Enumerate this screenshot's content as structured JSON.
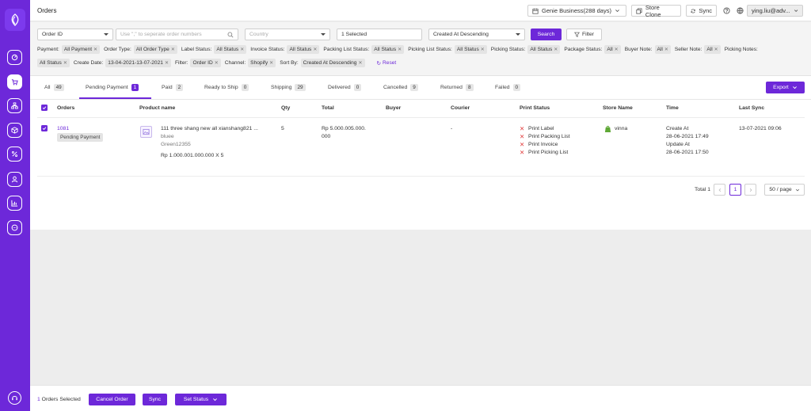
{
  "window": {
    "title": "Orders"
  },
  "topbar": {
    "business": "Genie Business(288 days)",
    "store_clone": "Store Clone",
    "sync": "Sync",
    "user": "ying.liu@adv..."
  },
  "filters": {
    "search_type": "Order ID",
    "order_numbers_placeholder": "Use \",\" to seperate order numbers",
    "country_placeholder": "Country",
    "selected": "1 Selected",
    "sort": "Created At Descending",
    "search_button": "Search",
    "filter_button": "Filter",
    "row1": [
      {
        "label": "Payment:",
        "value": "All Payment"
      },
      {
        "label": "Order Type:",
        "value": "All Order Type"
      },
      {
        "label": "Label Status:",
        "value": "All Status"
      },
      {
        "label": "Invoice Status:",
        "value": "All Status"
      },
      {
        "label": "Packing List Status:",
        "value": "All Status"
      },
      {
        "label": "Picking List Status:",
        "value": "All Status"
      },
      {
        "label": "Picking Status:",
        "value": "All Status"
      },
      {
        "label": "Package Status:",
        "value": "All"
      },
      {
        "label": "Buyer Note:",
        "value": "All"
      },
      {
        "label": "Seller Note:",
        "value": "All"
      },
      {
        "label": "Picking Notes:",
        "value": ""
      }
    ],
    "row2": [
      {
        "label": "",
        "value": "All Status"
      },
      {
        "label": "Create Date:",
        "value": "13-04-2021-13-07-2021"
      },
      {
        "label": "Filter:",
        "value": "Order ID"
      },
      {
        "label": "Channel:",
        "value": "Shopify"
      },
      {
        "label": "Sort By:",
        "value": "Created At Descending"
      }
    ],
    "reset": "Reset"
  },
  "tabs": [
    {
      "label": "All",
      "count": "49"
    },
    {
      "label": "Pending Payment",
      "count": "1"
    },
    {
      "label": "Paid",
      "count": "2"
    },
    {
      "label": "Ready to Ship",
      "count": "0"
    },
    {
      "label": "Shipping",
      "count": "29"
    },
    {
      "label": "Delivered",
      "count": "0"
    },
    {
      "label": "Cancelled",
      "count": "9"
    },
    {
      "label": "Returned",
      "count": "8"
    },
    {
      "label": "Failed",
      "count": "0"
    }
  ],
  "export_label": "Export",
  "table": {
    "columns": [
      "Orders",
      "Product name",
      "Qty",
      "Total",
      "Buyer",
      "Courier",
      "Print Status",
      "Store Name",
      "Time",
      "Last Sync"
    ],
    "rows": [
      {
        "order_id": "1081",
        "status": "Pending Payment",
        "product_name": "111 three shang new all xianshang821 ...",
        "variant1": "bluee",
        "variant2": "Green12355",
        "price_line": "Rp 1.000.001.000.000 X 5",
        "qty": "5",
        "total_line1": "Rp 5.000.005.000.",
        "total_line2": "000",
        "buyer": "",
        "courier": "-",
        "print_status": [
          "Print Label",
          "Print Packing List",
          "Print Invoice",
          "Print Picking List"
        ],
        "store_name": "vinna",
        "created_label": "Create At",
        "created_at": "28-06-2021 17:49",
        "updated_label": "Update At",
        "updated_at": "28-06-2021 17:50",
        "last_sync": "13-07-2021 09:06"
      }
    ]
  },
  "pagination": {
    "total": "Total 1",
    "page": "1",
    "page_size": "50 / page"
  },
  "bottom": {
    "selected_count": "1",
    "selected_text": "Orders Selected",
    "cancel_order": "Cancel Order",
    "sync": "Sync",
    "set_status": "Set Status"
  },
  "colors": {
    "accent": "#6d28d9",
    "error": "#e23b3b",
    "shopify": "#5fa836"
  }
}
